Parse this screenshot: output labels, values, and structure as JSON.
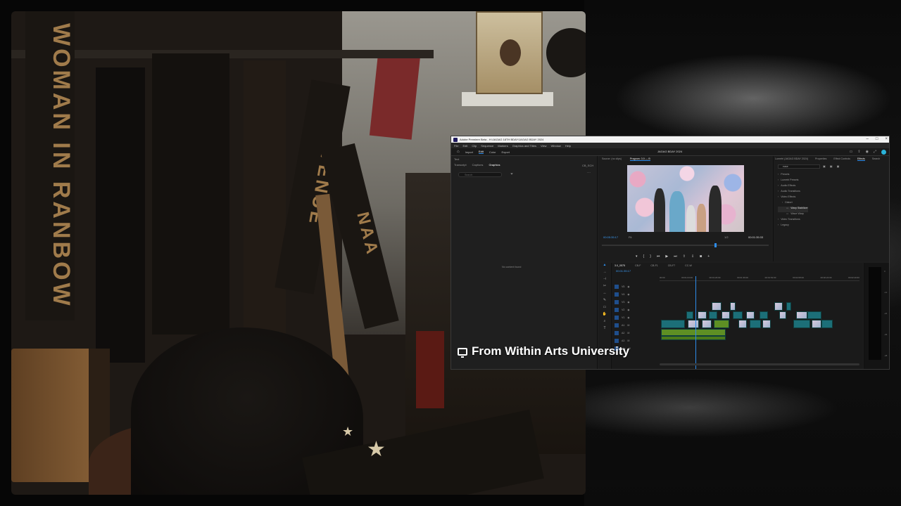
{
  "caption": {
    "text": "From Within Arts University",
    "icon": "monitor-icon"
  },
  "webcam": {
    "strap_text_1": "WOMAN IN RANBOW",
    "strap_text_2": "VENUE",
    "strap_text_3": "NAA"
  },
  "premiere": {
    "window_title": "Adobe Premiere Beta - H:\\JAGAG 18TH BDAY\\JAGAG BDAY 2024",
    "menu": [
      "File",
      "Edit",
      "Clip",
      "Sequence",
      "Markers",
      "Graphics and Titles",
      "View",
      "Window",
      "Help"
    ],
    "workspaces": [
      "Import",
      "Edit",
      "Color",
      "Export"
    ],
    "active_workspace": "Edit",
    "project_name": "JAGAG BDAY 2024",
    "left_panel": {
      "header": "Text",
      "tabs": [
        "Transcript",
        "Captions",
        "Graphics"
      ],
      "active_tab": "Graphics",
      "right_label": "CB_SCH",
      "search_placeholder": "Search",
      "empty_message": "No content found"
    },
    "monitor": {
      "tabs": [
        "Source: (no clips)",
        "Program: 3.0 — B"
      ],
      "timecode_left": "00:05:35:17",
      "timecode_right": "00:01:35:33",
      "fit": "Fit",
      "resolution": "1/2"
    },
    "effects_panel": {
      "tabs": [
        "Lumetri (JAGAG BDAY 2024)",
        "Properties",
        "Effect Controls",
        "Effects",
        "Search"
      ],
      "active_tab": "Effects",
      "search_value": "ease",
      "items": [
        {
          "label": "Presets",
          "level": 0
        },
        {
          "label": "Lumetri Presets",
          "level": 0
        },
        {
          "label": "Audio Effects",
          "level": 0
        },
        {
          "label": "Audio Transitions",
          "level": 0
        },
        {
          "label": "Video Effects",
          "level": 0
        },
        {
          "label": "Distort",
          "level": 1
        },
        {
          "label": "Warp Stabilizer",
          "level": 2,
          "selected": true
        },
        {
          "label": "Wave Warp",
          "level": 2
        },
        {
          "label": "Video Transitions",
          "level": 0
        },
        {
          "label": "Legacy",
          "level": 0
        }
      ]
    },
    "timeline": {
      "tabs": [
        "3.0_0575",
        "CB-F",
        "CB-F1",
        "CB-F7",
        "CC-W"
      ],
      "timecode": "00:01:35:17",
      "ruler": [
        "00:00",
        "00:01:04:00",
        "00:01:20:00",
        "00:01:36:00",
        "00:01:52:00",
        "00:02:08:00",
        "00:02:24:00",
        "00:02:40:00"
      ],
      "tracks": [
        "V5",
        "V4",
        "V3",
        "V2",
        "V1",
        "A1",
        "A2",
        "A3",
        "Mix"
      ]
    }
  }
}
